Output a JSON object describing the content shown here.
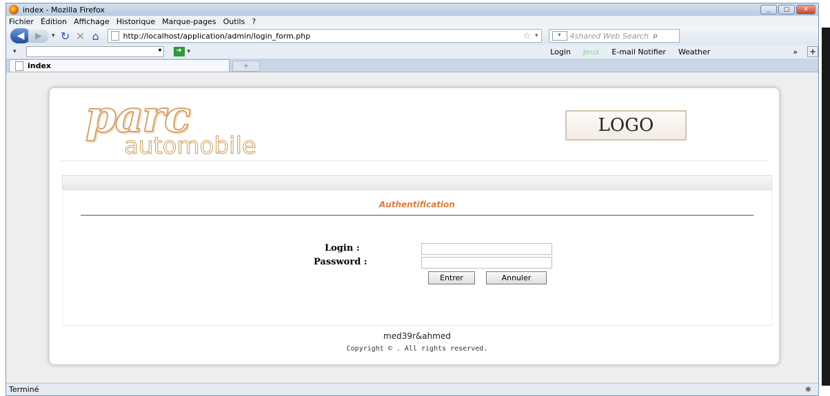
{
  "window": {
    "title": "index - Mozilla Firefox",
    "buttons": [
      "_",
      "□",
      "✕"
    ]
  },
  "menu": [
    "Fichier",
    "Édition",
    "Affichage",
    "Historique",
    "Marque-pages",
    "Outils",
    "?"
  ],
  "navbar": {
    "url": "http://localhost/application/admin/login_form.php",
    "search_placeholder": "4shared Web Search"
  },
  "toolbar2": {
    "items": [
      "Login",
      "Jeux",
      "E-mail Notifier",
      "Weather"
    ],
    "more": "»",
    "plus": "+"
  },
  "tabs": {
    "active_label": "index",
    "new_tab": "+"
  },
  "page": {
    "brand_top": "parc",
    "brand_bottom": "automobile",
    "logo_text": "LOGO",
    "auth_title": "Authentification",
    "login_label": "Login :",
    "password_label": "Password :",
    "login_value": "",
    "password_value": "",
    "submit_label": "Entrer",
    "cancel_label": "Annuler",
    "author": "med39r&ahmed",
    "copyright": "Copyright © . All rights reserved."
  },
  "status": {
    "text": "Terminé"
  },
  "colors": {
    "accent_orange": "#e07a3a",
    "window_blue": "#dfe7f1"
  }
}
